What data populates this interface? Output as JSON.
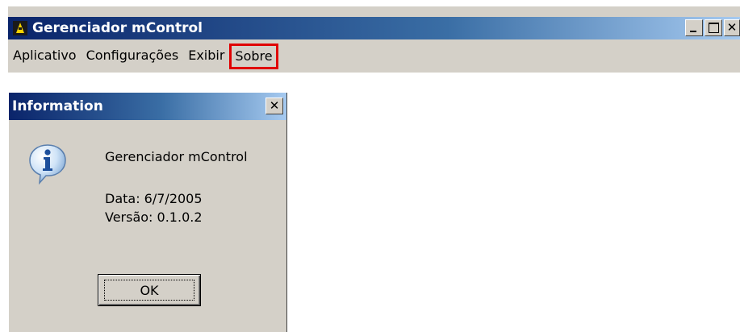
{
  "main_window": {
    "title": "Gerenciador mControl",
    "menu": {
      "items": [
        {
          "label": "Aplicativo"
        },
        {
          "label": "Configurações"
        },
        {
          "label": "Exibir"
        },
        {
          "label": "Sobre",
          "highlighted": true
        }
      ]
    },
    "caption_buttons": {
      "minimize": "minimize-icon",
      "maximize": "maximize-icon",
      "close_glyph": "✕"
    }
  },
  "dialog": {
    "title": "Information",
    "close_glyph": "✕",
    "icon": "info-icon",
    "app_name": "Gerenciador mControl",
    "date": "Data: 6/7/2005",
    "version": "Versão: 0.1.0.2",
    "ok_label": "OK"
  },
  "colors": {
    "titlebar_start": "#0a246a",
    "titlebar_end": "#a6caf0",
    "face": "#d4d0c8",
    "menu_highlight_border": "#e00000"
  }
}
